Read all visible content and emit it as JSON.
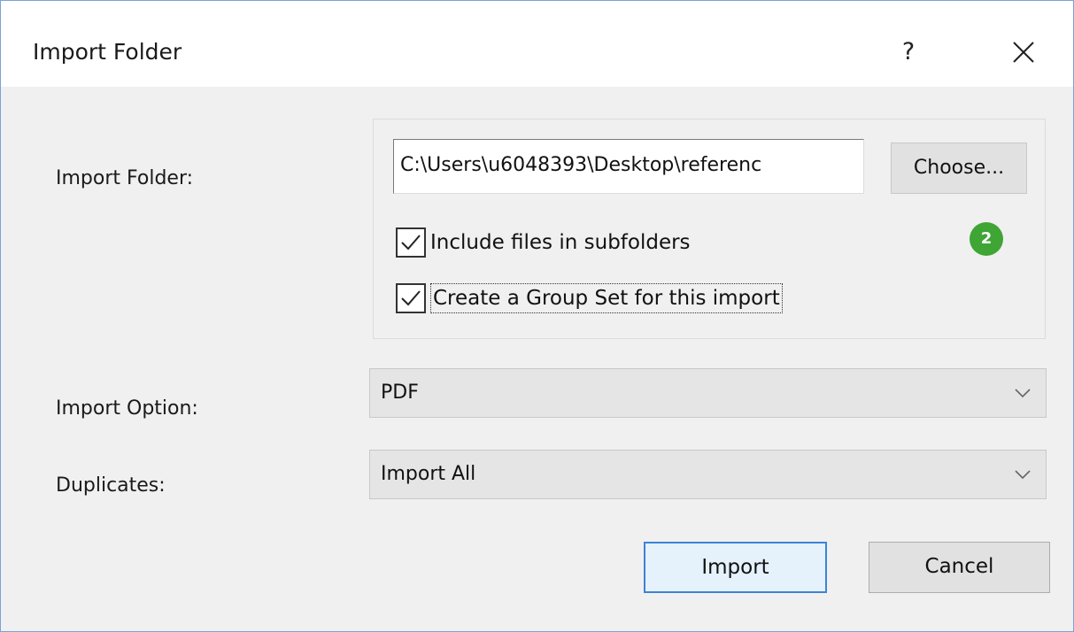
{
  "window": {
    "title": "Import Folder",
    "help_label": "?",
    "close_icon": "close-icon"
  },
  "form": {
    "import_folder_label": "Import Folder:",
    "path_value": "C:\\Users\\u6048393\\Desktop\\referenc",
    "choose_label": "Choose...",
    "include_subfolders": {
      "label": "Include files in subfolders",
      "checked": true
    },
    "create_group_set": {
      "label": "Create a Group Set for this import",
      "checked": true,
      "focused": true
    },
    "badge": "2",
    "import_option_label": "Import Option:",
    "import_option_value": "PDF",
    "duplicates_label": "Duplicates:",
    "duplicates_value": "Import All"
  },
  "buttons": {
    "import_label": "Import",
    "cancel_label": "Cancel"
  },
  "colors": {
    "window_border": "#7aa3d6",
    "badge_green": "#3fa535",
    "primary_border": "#3c84d4",
    "dialog_bg": "#f0f0f0"
  }
}
